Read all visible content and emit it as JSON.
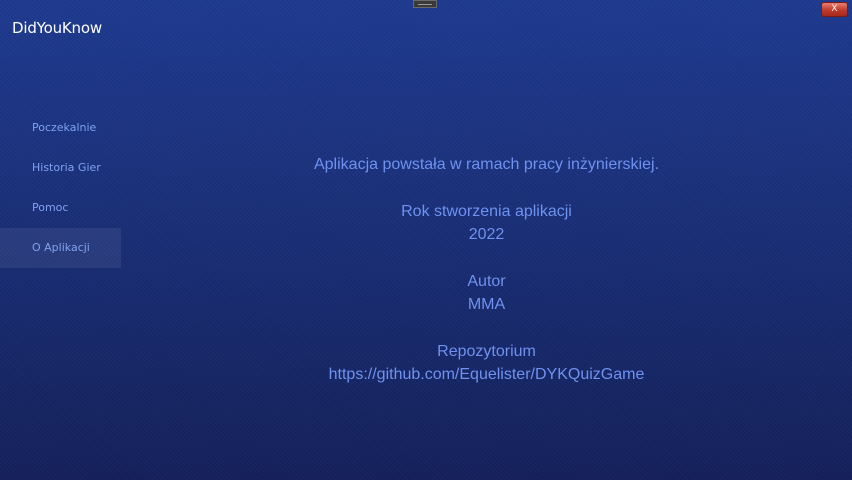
{
  "window": {
    "title": "DidYouKnow",
    "close_label": "X"
  },
  "sidebar": {
    "items": [
      {
        "label": "Poczekalnie",
        "active": false
      },
      {
        "label": "Historia Gier",
        "active": false
      },
      {
        "label": "Pomoc",
        "active": false
      },
      {
        "label": "O Aplikacji",
        "active": true
      }
    ]
  },
  "about": {
    "description": "Aplikacja powstała w ramach pracy inżynierskiej.",
    "year_label": "Rok stworzenia aplikacji",
    "year_value": "2022",
    "author_label": "Autor",
    "author_value": "MMA",
    "repo_label": "Repozytorium",
    "repo_value": "https://github.com/Equelister/DYKQuizGame"
  },
  "colors": {
    "background_top": "#1e3a8f",
    "background_bottom": "#14205a",
    "accent_text": "#6e92ee",
    "nav_text": "#7fa2f0",
    "close_button": "#c0392b"
  }
}
